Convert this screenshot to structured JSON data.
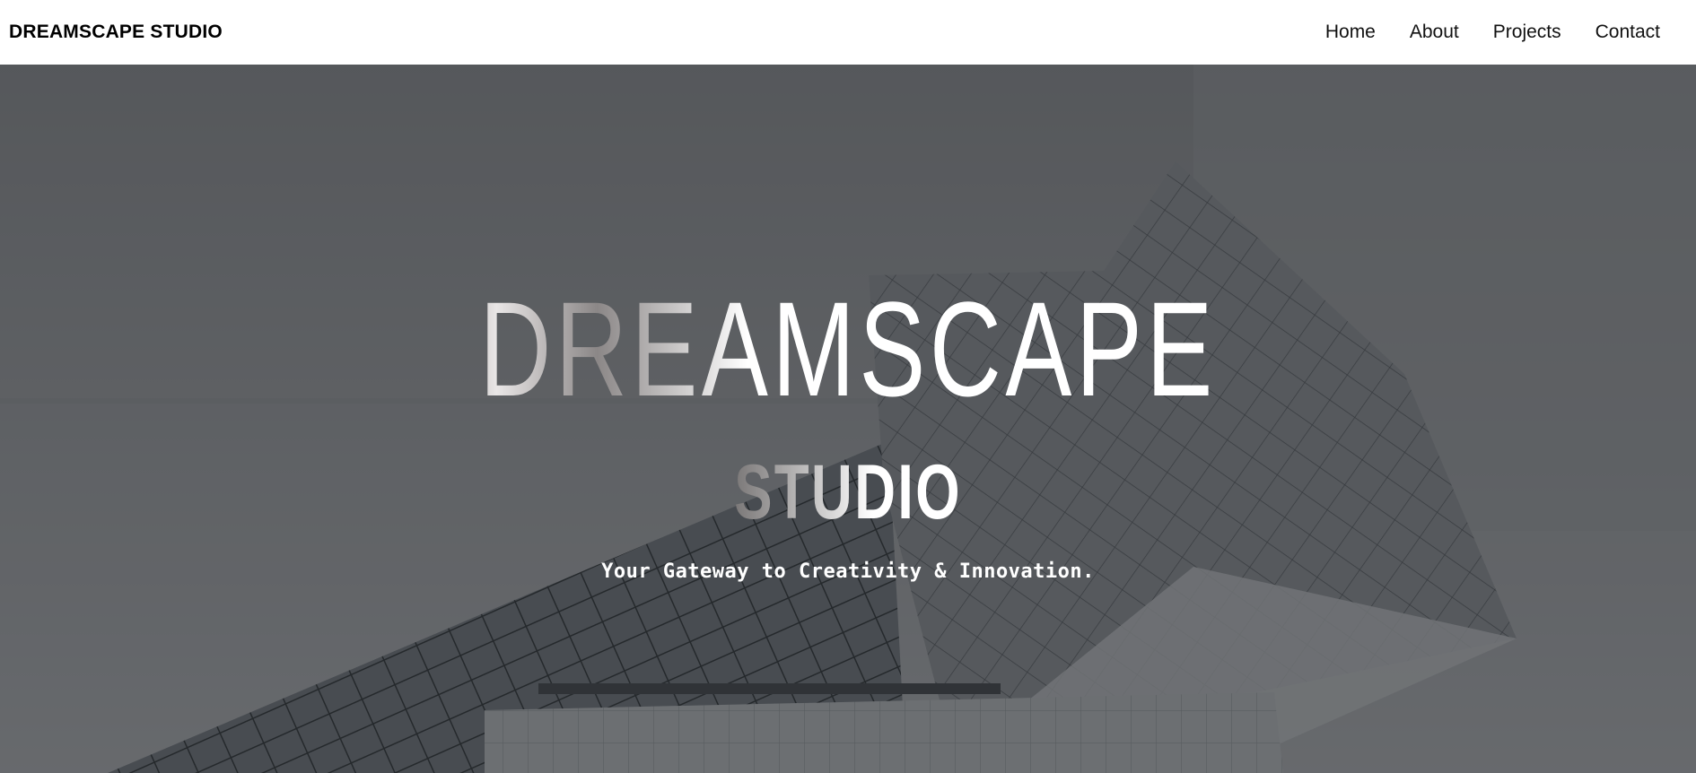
{
  "navbar": {
    "brand": "DREAMSCAPE STUDIO",
    "links": [
      "Home",
      "About",
      "Projects",
      "Contact"
    ]
  },
  "hero": {
    "title": "DREAMSCAPE",
    "subtitle": "STUDIO",
    "tagline": "Your Gateway to Creativity & Innovation.",
    "background_image": "modern-glass-building-photo",
    "overlay_color": "#2a2c30"
  }
}
